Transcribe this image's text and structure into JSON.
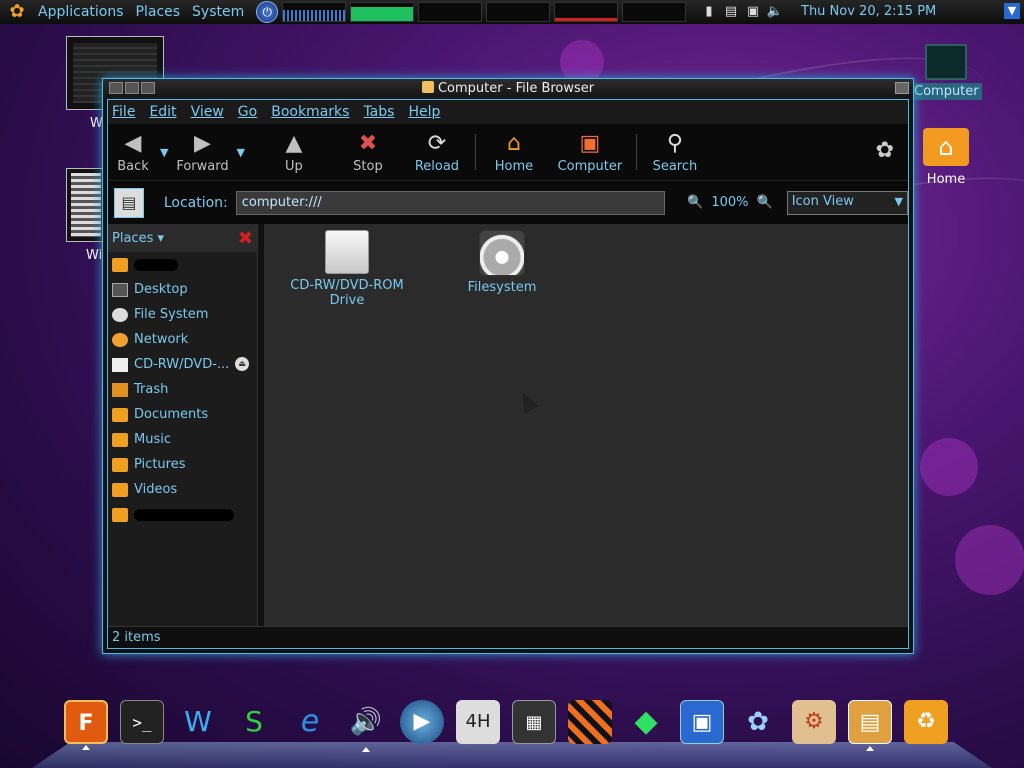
{
  "top_panel": {
    "menus": [
      "Applications",
      "Places",
      "System"
    ],
    "clock": "Thu Nov 20,  2:15 PM"
  },
  "desktop": {
    "thumb_labels": [
      "Wi",
      "Wi"
    ],
    "icons": [
      {
        "label": "Computer",
        "selected": true
      },
      {
        "label": "Home",
        "selected": false
      }
    ]
  },
  "window": {
    "title": "Computer - File Browser",
    "menu": [
      "File",
      "Edit",
      "View",
      "Go",
      "Bookmarks",
      "Tabs",
      "Help"
    ],
    "toolbar": {
      "back": "Back",
      "forward": "Forward",
      "up": "Up",
      "stop": "Stop",
      "reload": "Reload",
      "home": "Home",
      "computer": "Computer",
      "search": "Search"
    },
    "location": {
      "label": "Location:",
      "value": "computer:///",
      "zoom": "100%",
      "view_mode": "Icon View"
    },
    "sidebar": {
      "header": "Places",
      "items": [
        {
          "label": "",
          "redacted": true
        },
        {
          "label": "Desktop"
        },
        {
          "label": "File System"
        },
        {
          "label": "Network"
        },
        {
          "label": "CD-RW/DVD-..."
        },
        {
          "label": "Trash"
        },
        {
          "label": "Documents"
        },
        {
          "label": "Music"
        },
        {
          "label": "Pictures"
        },
        {
          "label": "Videos"
        },
        {
          "label": "",
          "redacted": true
        }
      ]
    },
    "files": [
      {
        "label": "CD-RW/DVD-ROM Drive"
      },
      {
        "label": "Filesystem"
      }
    ],
    "status": "2 items"
  },
  "colors": {
    "accent": "#7cc9ef",
    "window_border": "#4fb8e6"
  }
}
